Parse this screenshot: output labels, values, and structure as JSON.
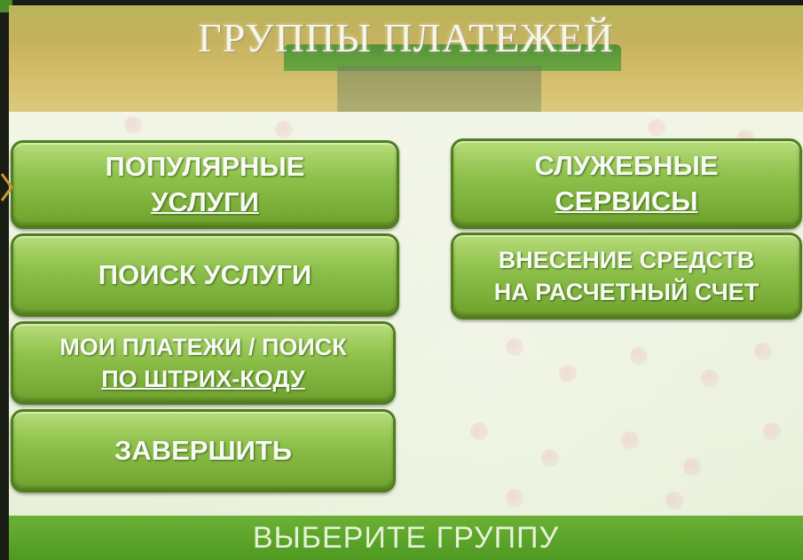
{
  "header": {
    "title": "ГРУППЫ ПЛАТЕЖЕЙ"
  },
  "buttons": {
    "popular": {
      "line1": "ПОПУЛЯРНЫЕ",
      "line2": "УСЛУГИ"
    },
    "service": {
      "line1": "СЛУЖЕБНЫЕ",
      "line2": "СЕРВИСЫ"
    },
    "search": {
      "label": "ПОИСК УСЛУГИ"
    },
    "deposit": {
      "line1": "ВНЕСЕНИЕ СРЕДСТВ",
      "line2": "НА РАСЧЕТНЫЙ СЧЕТ"
    },
    "my_payments": {
      "line1": "МОИ ПЛАТЕЖИ / ПОИСК",
      "line2": "ПО ШТРИХ-КОДУ"
    },
    "finish": {
      "label": "ЗАВЕРШИТЬ"
    }
  },
  "status": {
    "text": "ВЫБЕРИТЕ ГРУППУ"
  },
  "icons": {
    "side_indicator": "chevron-right-icon"
  },
  "colors": {
    "accent_green": "#6ea22c",
    "border_green": "#4f7e1c",
    "status_green": "#4f9a22"
  }
}
